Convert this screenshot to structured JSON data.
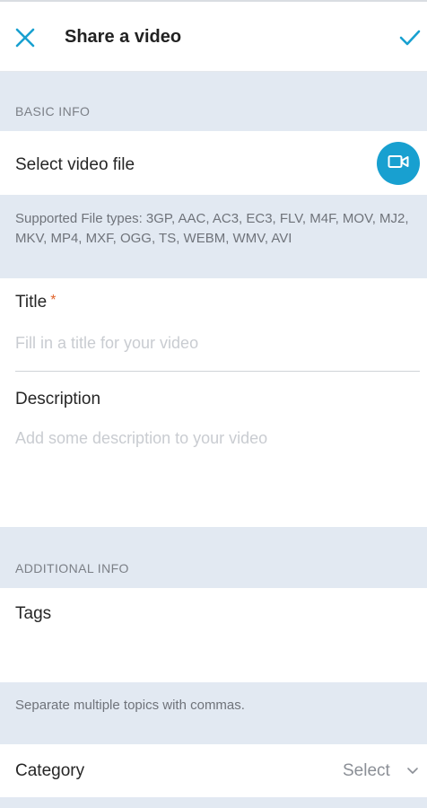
{
  "header": {
    "title": "Share a video",
    "close_icon": "close-icon",
    "confirm_icon": "checkmark-icon"
  },
  "basic_info": {
    "section_label": "BASIC INFO",
    "select_video_label": "Select video file",
    "video_button_icon": "video-camera-icon",
    "supported_types_text": "Supported File types: 3GP, AAC, AC3, EC3, FLV, M4F, MOV, MJ2, MKV, MP4, MXF, OGG, TS, WEBM, WMV, AVI"
  },
  "title_field": {
    "label": "Title",
    "required_mark": "*",
    "placeholder": "Fill in a title for your video"
  },
  "description_field": {
    "label": "Description",
    "placeholder": "Add some description to your video"
  },
  "additional_info": {
    "section_label": "ADDITIONAL INFO",
    "tags_label": "Tags",
    "tags_help": "Separate multiple topics with commas.",
    "category_label": "Category",
    "category_value": "Select"
  },
  "colors": {
    "accent": "#18a0d0",
    "background_band": "#e2e9f2",
    "required": "#e0632b"
  }
}
